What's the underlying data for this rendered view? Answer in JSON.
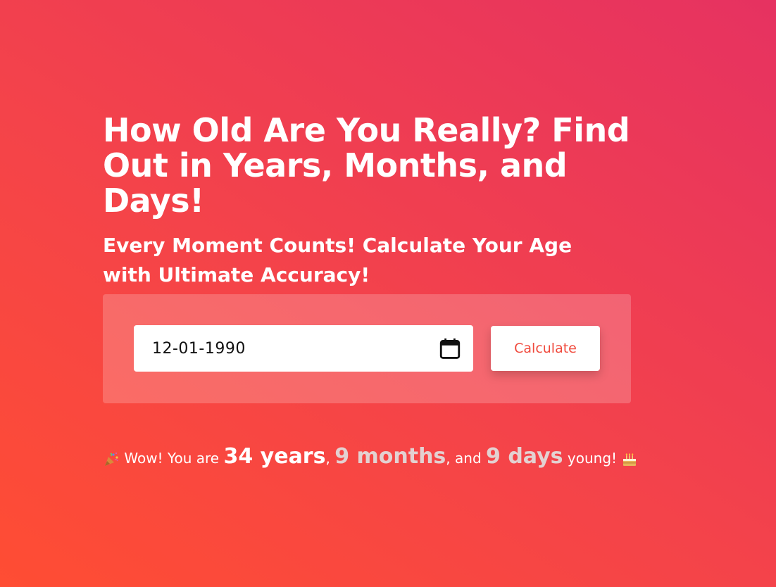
{
  "hero": {
    "title": "How Old Are You Really? Find Out in Years, Months, and Days!",
    "subtitle": "Every Moment Counts! Calculate Your Age with Ultimate Accuracy!"
  },
  "form": {
    "date_value": "12-01-1990",
    "calendar_icon": "calendar-icon",
    "calculate_label": "Calculate"
  },
  "result": {
    "prefix": "Wow! You are",
    "years": "34 years",
    "sep1": ",",
    "months": "9 months",
    "sep2": ", and",
    "days": "9 days",
    "suffix": "young!",
    "lead_icon": "party-popper-icon",
    "trail_icon": "birthday-cake-icon"
  },
  "colors": {
    "gradient_start": "#ff4d33",
    "gradient_end": "#e63261",
    "button_text": "#f04a3d"
  }
}
